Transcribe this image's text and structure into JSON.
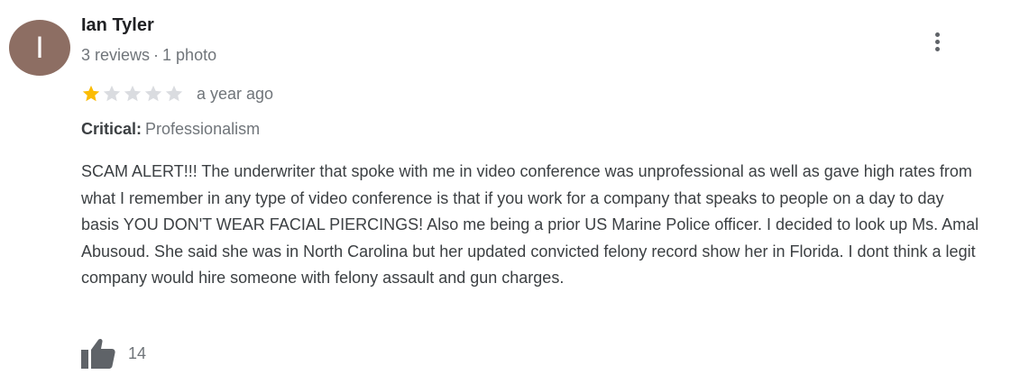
{
  "review": {
    "author": {
      "initial": "I",
      "name": "Ian Tyler",
      "reviews": "3 reviews",
      "separator": "·",
      "photos": "1 photo",
      "avatar_color": "#8d6e63"
    },
    "rating": {
      "stars": 1,
      "max": 5,
      "filled_color": "#fbbc04",
      "empty_color": "#dadce0"
    },
    "date": "a year ago",
    "critical": {
      "label": "Critical:",
      "value": "Professionalism"
    },
    "text": "SCAM ALERT!!! The underwriter that spoke with me in video conference was unprofessional as well as gave high rates from what I remember in any type of video conference is that if you work for a company that speaks to people on a day to day basis YOU DON'T WEAR FACIAL PIERCINGS! Also me being a prior US Marine Police officer. I decided to look up Ms. Amal Abusoud. She said she was in North Carolina but her updated convicted felony record show her in Florida. I dont think a legit company would hire someone with felony assault and gun charges.",
    "likes": "14",
    "icons": {
      "more": "more-vert-icon",
      "like": "thumbs-up-icon"
    }
  }
}
